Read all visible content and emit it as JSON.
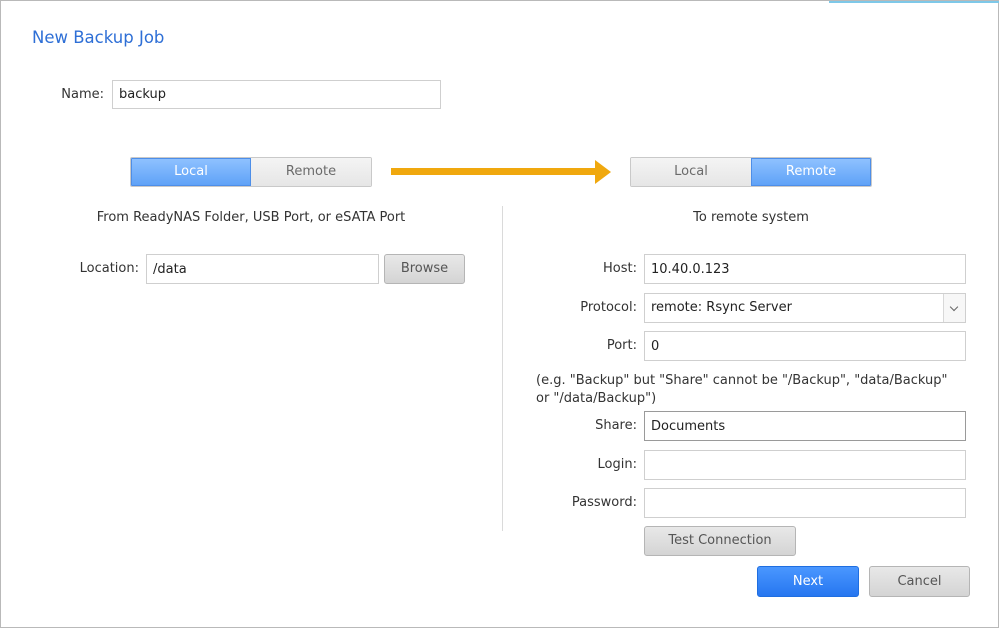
{
  "dialog": {
    "title": "New Backup Job"
  },
  "name": {
    "label": "Name:",
    "value": "backup"
  },
  "source": {
    "toggle": {
      "local": "Local",
      "remote": "Remote",
      "selected": "Local"
    },
    "caption": "From ReadyNAS Folder, USB Port, or eSATA Port",
    "location_label": "Location:",
    "location_value": "/data",
    "browse_label": "Browse"
  },
  "destination": {
    "toggle": {
      "local": "Local",
      "remote": "Remote",
      "selected": "Remote"
    },
    "caption": "To remote system",
    "host_label": "Host:",
    "host_value": "10.40.0.123",
    "protocol_label": "Protocol:",
    "protocol_value": "remote: Rsync Server",
    "port_label": "Port:",
    "port_value": "0",
    "share_hint": "(e.g. \"Backup\" but \"Share\" cannot be \"/Backup\", \"data/Backup\" or \"/data/Backup\")",
    "share_label": "Share:",
    "share_value": "Documents",
    "login_label": "Login:",
    "login_value": "",
    "password_label": "Password:",
    "password_value": "",
    "test_connection_label": "Test Connection"
  },
  "footer": {
    "next_label": "Next",
    "cancel_label": "Cancel"
  },
  "colors": {
    "accent": "#2e6fd6",
    "toggle_active": "#6aa9fa",
    "arrow": "#f0a80e",
    "primary_button": "#2676f0"
  }
}
